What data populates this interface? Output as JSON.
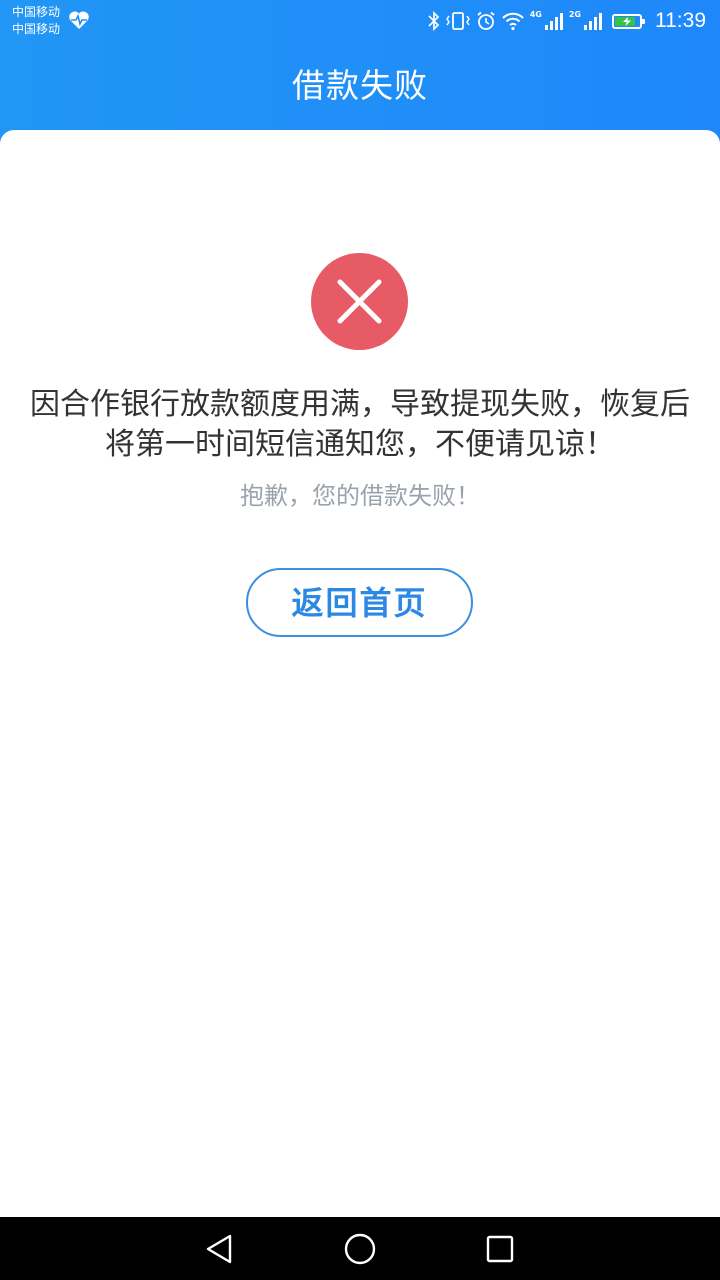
{
  "status_bar": {
    "carrier_1": "中国移动",
    "carrier_2": "中国移动",
    "network_1": "4G",
    "network_2": "2G",
    "time": "11:39",
    "icons": [
      "heart-pulse-icon",
      "bluetooth-icon",
      "vibrate-icon",
      "alarm-icon",
      "wifi-icon",
      "signal-icon",
      "signal-icon",
      "battery-charging-icon"
    ],
    "battery_level": 0.85,
    "battery_color": "#35c24a"
  },
  "header": {
    "title": "借款失败"
  },
  "result": {
    "icon": "close-circle-icon",
    "icon_color": "#e65b66",
    "message": "因合作银行放款额度用满，导致提现失败，恢复后将第一时间短信通知您，不便请见谅！",
    "subtitle": "抱歉，您的借款失败！"
  },
  "actions": {
    "home_button_label": "返回首页"
  },
  "nav_bar": {
    "icons": [
      "back-icon",
      "home-icon",
      "recents-icon"
    ]
  },
  "colors": {
    "header_start": "#2196f5",
    "header_end": "#1e88fb",
    "accent": "#2d88e3"
  }
}
